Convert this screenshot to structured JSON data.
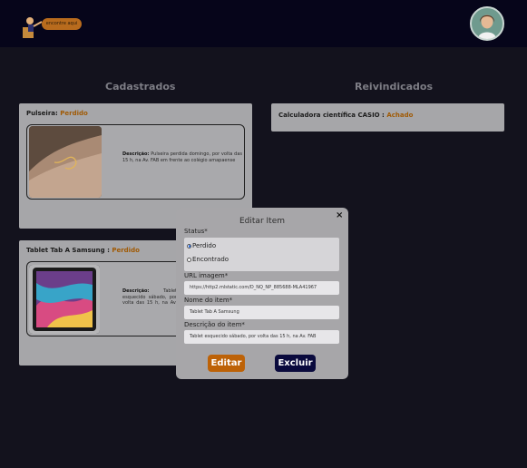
{
  "header": {
    "logo_text": "encontre aqui"
  },
  "columns": {
    "registered_title": "Cadastrados",
    "claimed_title": "Reivindicados"
  },
  "registered_items": [
    {
      "name": "Pulseira",
      "separator": ": ",
      "status": "Perdido",
      "desc_label": "Descrição:",
      "desc_text": "Pulseira perdida domingo, por volta das 15 h, na Av. FAB em frente ao colégio amapaense"
    },
    {
      "name": "Tablet Tab A Samsung",
      "separator": " : ",
      "status": "Perdido",
      "desc_label": "Descrição:",
      "desc_text": "Tablet esquecido sábado, por volta das 15 h, na Av. FAB em frente ao colégio amapaense"
    }
  ],
  "claimed_items": [
    {
      "name": "Calculadora científica CASIO",
      "separator": " : ",
      "status": "Achado"
    }
  ],
  "modal": {
    "title": "Editar Item",
    "close": "×",
    "status_label": "Status*",
    "options": [
      "Perdido",
      "Encontrado"
    ],
    "selected_option": "Perdido",
    "url_label": "URL imagem*",
    "url_value": "https://http2.mlstatic.com/D_NQ_NP_885688-MLA41967",
    "name_label": "Nome do item*",
    "name_value": "Tablet Tab A Samsung",
    "desc_label": "Descrição do item*",
    "desc_value": "Tablet esquecido sábado, por volta das 15 h, na Av. FAB",
    "edit_button": "Editar",
    "delete_button": "Excluir"
  },
  "colors": {
    "background": "#0b0a17",
    "card": "#a6a6a9",
    "status_accent": "#a05a05",
    "edit_button": "#bd6207",
    "delete_button": "#0a0a3d"
  },
  "icons": [
    "logo-icon",
    "avatar-icon",
    "close-icon"
  ]
}
